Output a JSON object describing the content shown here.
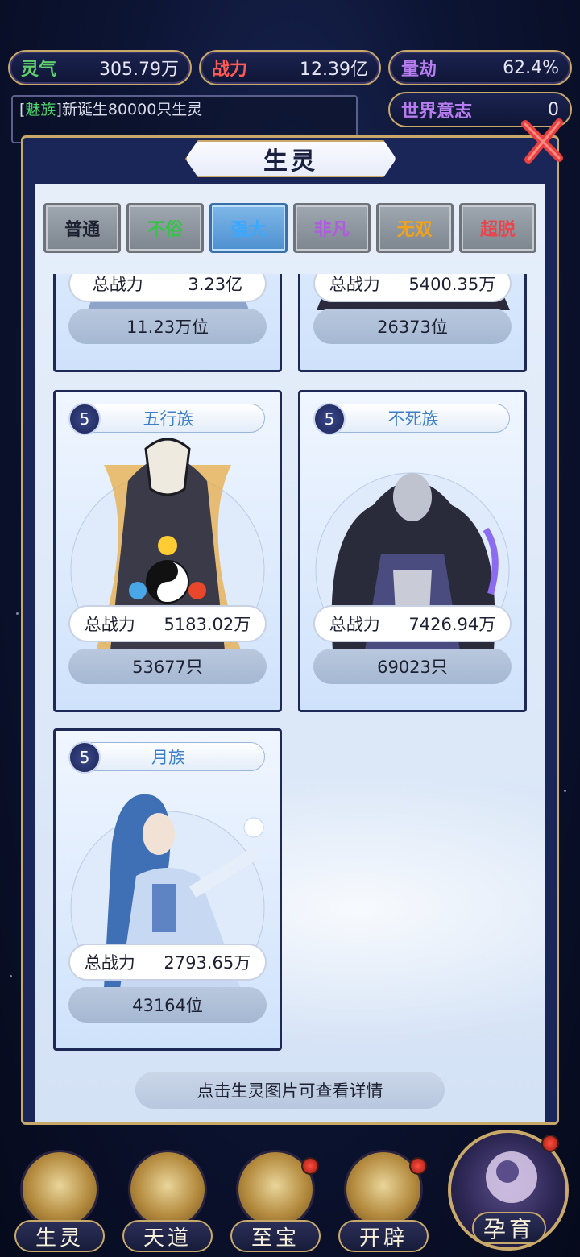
{
  "resources": [
    {
      "label": "灵气",
      "value": "305.79万"
    },
    {
      "label": "战力",
      "value": "12.39亿"
    },
    {
      "label": "量劫",
      "value": "62.4%"
    }
  ],
  "log": {
    "tag": "魅族",
    "text": "新诞生80000只生灵"
  },
  "world_will": {
    "label": "世界意志",
    "value": "0"
  },
  "panel": {
    "title": "生灵",
    "hint": "点击生灵图片可查看详情"
  },
  "tabs": [
    {
      "label": "普通",
      "color": "#1d2030"
    },
    {
      "label": "不俗",
      "color": "#37c24a"
    },
    {
      "label": "强大",
      "color": "#3aa8ff"
    },
    {
      "label": "非凡",
      "color": "#b05ce0"
    },
    {
      "label": "无双",
      "color": "#f2a21a"
    },
    {
      "label": "超脱",
      "color": "#e8464c"
    }
  ],
  "power_label": "总战力",
  "cards": [
    {
      "level": "",
      "name": "",
      "power": "3.23亿",
      "count": "11.23万位"
    },
    {
      "level": "",
      "name": "",
      "power": "5400.35万",
      "count": "26373位"
    },
    {
      "level": "5",
      "name": "五行族",
      "power": "5183.02万",
      "count": "53677只"
    },
    {
      "level": "5",
      "name": "不死族",
      "power": "7426.94万",
      "count": "69023只"
    },
    {
      "level": "5",
      "name": "月族",
      "power": "2793.65万",
      "count": "43164位"
    }
  ],
  "nav": [
    {
      "label": "生灵"
    },
    {
      "label": "天道"
    },
    {
      "label": "至宝"
    },
    {
      "label": "开辟"
    },
    {
      "label": "孕育"
    }
  ]
}
